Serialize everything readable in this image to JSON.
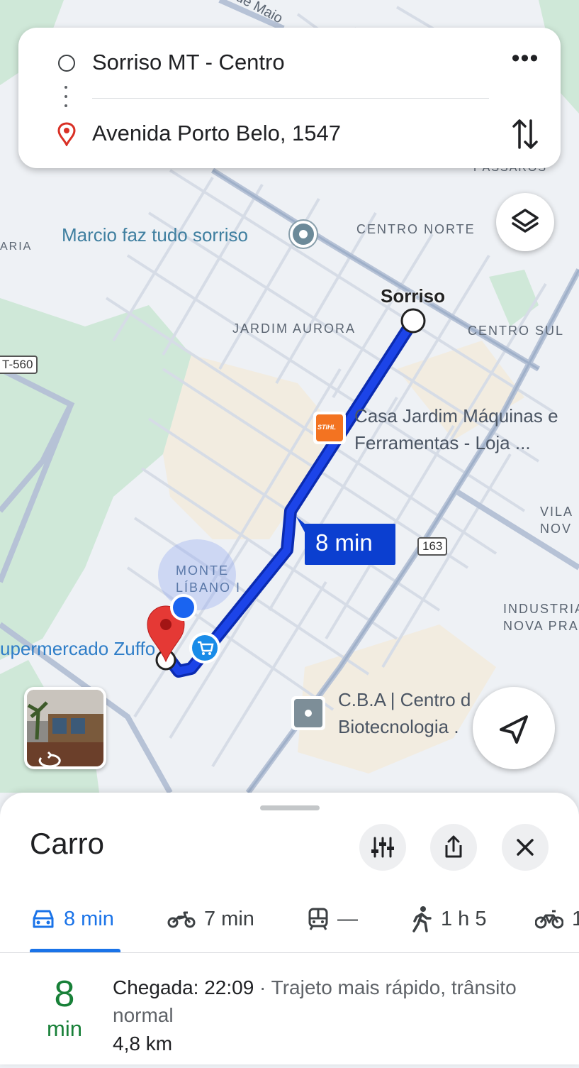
{
  "route": {
    "origin": "Sorriso MT - Centro",
    "destination": "Avenida Porto Belo, 1547",
    "more_label": "•••"
  },
  "map": {
    "labels": {
      "street_top": "de Maio",
      "passaros": "PÁSSAROS",
      "aria": "ARIA",
      "marcio": "Marcio faz tudo sorriso",
      "centro_norte": "CENTRO NORTE",
      "sorriso": "Sorriso",
      "jardim_aurora": "JARDIM AURORA",
      "centro_sul": "CENTRO SUL",
      "road_560": "T-560",
      "casa_line1": "Casa Jardim Máquinas e",
      "casa_line2": "Ferramentas - Loja ...",
      "stihl": "STIHL",
      "vila_line1": "VILA",
      "vila_line2": "NOV",
      "route_time": "8 min",
      "road_163": "163",
      "monte_line1": "MONTE",
      "monte_line2": "LÍBANO I",
      "industrial_line1": "INDUSTRIA",
      "industrial_line2": "NOVA PRA",
      "supermercado": "upermercado Zuffo",
      "cba_line1": "C.B.A | Centro d",
      "cba_line2": "Biotecnologia ."
    },
    "colors": {
      "route": "#1a3fd6",
      "route_outline": "#0b2bb0",
      "pin": "#e53935",
      "my_location": "#1a73e8",
      "label_bg": "#0b3fd0"
    }
  },
  "sheet": {
    "title": "Carro",
    "modes": [
      {
        "icon": "car-icon",
        "label": "8 min",
        "active": true
      },
      {
        "icon": "motorcycle-icon",
        "label": "7 min",
        "active": false
      },
      {
        "icon": "transit-icon",
        "label": "—",
        "active": false
      },
      {
        "icon": "walk-icon",
        "label": "1 h 5",
        "active": false
      },
      {
        "icon": "bike-icon",
        "label": "1",
        "active": false
      }
    ],
    "result": {
      "duration_value": "8",
      "duration_unit": "min",
      "arrival_label": "Chegada: 22:09",
      "arrival_detail": " · Trajeto mais rápido, trânsito normal",
      "distance": "4,8 km"
    }
  }
}
